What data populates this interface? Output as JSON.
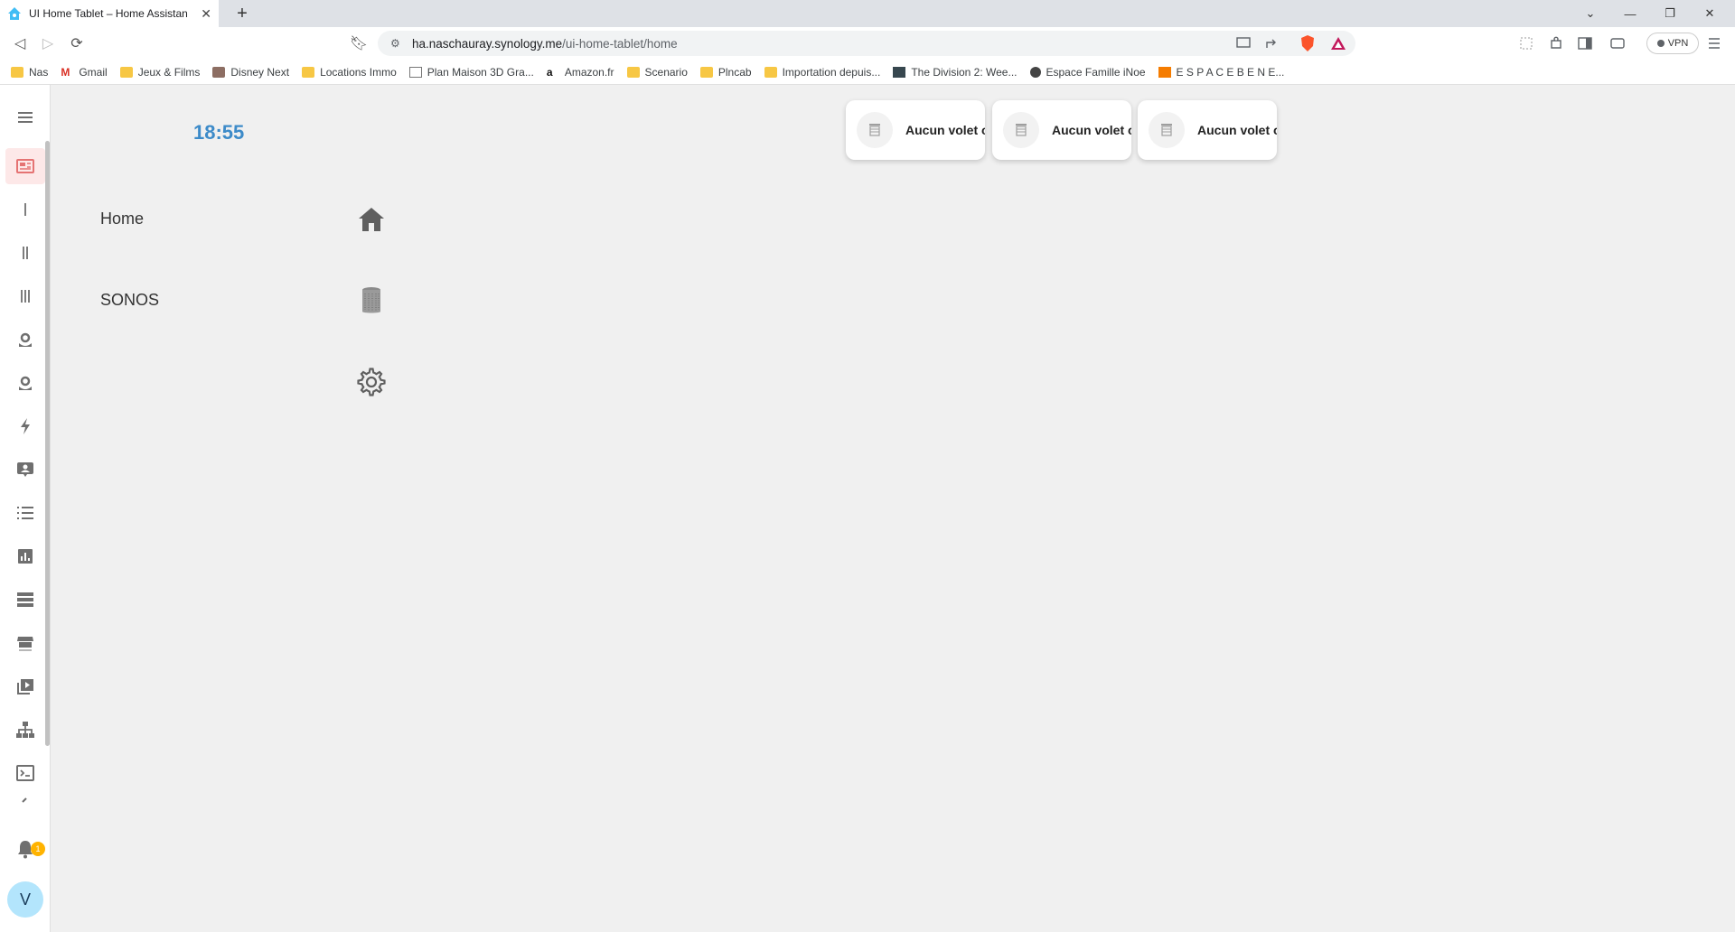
{
  "browser": {
    "tab_title": "UI Home Tablet – Home Assistan",
    "tab_close": "✕",
    "new_tab": "+",
    "url_host": "ha.naschauray.synology.me",
    "url_path": "/ui-home-tablet/home",
    "vpn_label": "VPN",
    "bookmarks": [
      {
        "label": "Nas",
        "icon": "folder"
      },
      {
        "label": "Gmail",
        "icon": "gmail"
      },
      {
        "label": "Jeux & Films",
        "icon": "folder"
      },
      {
        "label": "Disney Next",
        "icon": "site"
      },
      {
        "label": "Locations Immo",
        "icon": "folder"
      },
      {
        "label": "Plan Maison 3D Gra...",
        "icon": "site"
      },
      {
        "label": "Amazon.fr",
        "icon": "amazon"
      },
      {
        "label": "Scenario",
        "icon": "folder"
      },
      {
        "label": "Plncab",
        "icon": "folder"
      },
      {
        "label": "Importation depuis...",
        "icon": "folder"
      },
      {
        "label": "The Division 2: Wee...",
        "icon": "site"
      },
      {
        "label": "Espace Famille iNoe",
        "icon": "globe"
      },
      {
        "label": "E S P A C E B E N E...",
        "icon": "site"
      }
    ]
  },
  "sidebar": {
    "notification_count": "1",
    "avatar_initial": "V"
  },
  "dashboard": {
    "clock": "18:55",
    "menu": [
      {
        "label": "Home",
        "icon": "home-icon"
      },
      {
        "label": "SONOS",
        "icon": "speaker-icon"
      },
      {
        "label": "",
        "icon": "gear-icon"
      }
    ],
    "cards": [
      {
        "label": "Aucun volet ouvert"
      },
      {
        "label": "Aucun volet ouvert"
      },
      {
        "label": "Aucun volet ouvert"
      }
    ]
  },
  "colors": {
    "accent": "#3d8bc9",
    "active_item": "#e57373"
  }
}
